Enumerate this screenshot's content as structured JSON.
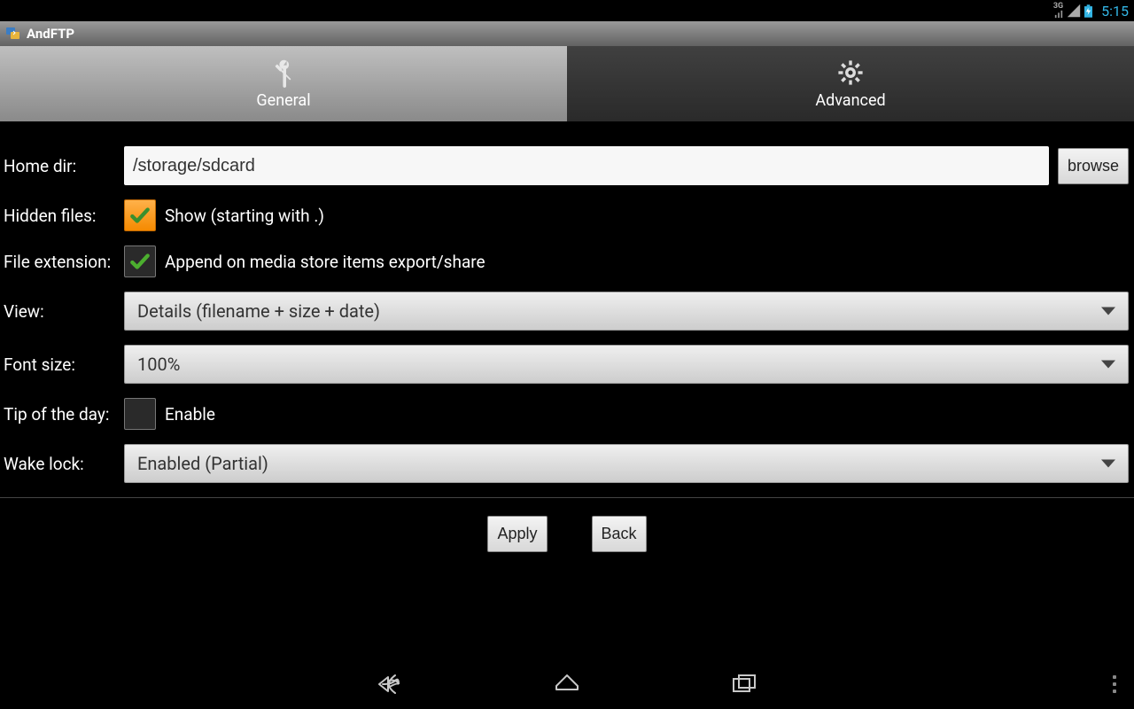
{
  "statusbar": {
    "signal_label": "3G",
    "time": "5:15"
  },
  "titlebar": {
    "app_name": "AndFTP"
  },
  "tabs": {
    "general": "General",
    "advanced": "Advanced"
  },
  "settings": {
    "home_dir_label": "Home dir:",
    "home_dir_value": "/storage/sdcard",
    "browse_label": "browse",
    "hidden_files_label": "Hidden files:",
    "hidden_files_text": "Show (starting with .)",
    "file_ext_label": "File extension:",
    "file_ext_text": "Append on media store items export/share",
    "view_label": "View:",
    "view_value": "Details (filename + size + date)",
    "font_size_label": "Font size:",
    "font_size_value": "100%",
    "tip_label": "Tip of the day:",
    "tip_text": "Enable",
    "wake_lock_label": "Wake lock:",
    "wake_lock_value": "Enabled (Partial)"
  },
  "actions": {
    "apply": "Apply",
    "back": "Back"
  }
}
